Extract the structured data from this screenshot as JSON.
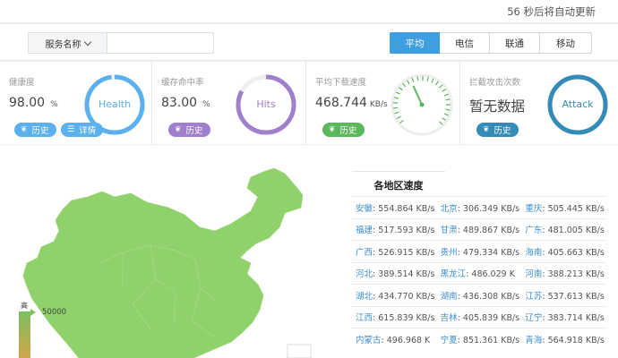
{
  "header": {
    "refresh_text": "56 秒后将自动更新"
  },
  "toolbar": {
    "service_select": "服务名称",
    "search_value": "",
    "isp_tabs": [
      {
        "label": "平均",
        "active": true
      },
      {
        "label": "电信",
        "active": false
      },
      {
        "label": "联通",
        "active": false
      },
      {
        "label": "移动",
        "active": false
      }
    ]
  },
  "cards": {
    "health": {
      "title": "健康度",
      "value": "98.00",
      "unit": "%",
      "ring_label": "Health",
      "ring_percent": 98.0,
      "history": "历史",
      "details": "详情",
      "color": "#5ab1ee"
    },
    "cache": {
      "title": "缓存命中率",
      "value": "83.00",
      "unit": "%",
      "ring_label": "Hits",
      "ring_percent": 83.0,
      "history": "历史",
      "color": "#a07fcd"
    },
    "speed": {
      "title": "平均下载速度",
      "value": "468.744",
      "unit": "KB/s",
      "history": "历史",
      "color": "#5cb85c"
    },
    "attack": {
      "title": "拦截攻击次数",
      "value": "暂无数据",
      "ring_label": "Attack",
      "ring_percent": 100,
      "history": "历史",
      "color": "#338bb8"
    }
  },
  "map": {
    "legend_high": "高",
    "legend_max": "50000",
    "fill_color": "#8fd16a"
  },
  "regions": {
    "title": "各地区速度",
    "rows": [
      [
        {
          "name": "安徽",
          "speed": "554.864 KB/s"
        },
        {
          "name": "北京",
          "speed": "306.349 KB/s"
        },
        {
          "name": "重庆",
          "speed": "505.445 KB/s"
        }
      ],
      [
        {
          "name": "福建",
          "speed": "517.593 KB/s"
        },
        {
          "name": "甘肃",
          "speed": "489.867 KB/s"
        },
        {
          "name": "广东",
          "speed": "481.005 KB/s"
        }
      ],
      [
        {
          "name": "广西",
          "speed": "526.915 KB/s"
        },
        {
          "name": "贵州",
          "speed": "479.334 KB/s"
        },
        {
          "name": "海南",
          "speed": "405.663 KB/s"
        }
      ],
      [
        {
          "name": "河北",
          "speed": "389.514 KB/s"
        },
        {
          "name": "黑龙江",
          "speed": "486.029 K"
        },
        {
          "name": "河南",
          "speed": "388.213 KB/s"
        }
      ],
      [
        {
          "name": "湖北",
          "speed": "434.770 KB/s"
        },
        {
          "name": "湖南",
          "speed": "436.308 KB/s"
        },
        {
          "name": "江苏",
          "speed": "537.613 KB/s"
        }
      ],
      [
        {
          "name": "江西",
          "speed": "615.839 KB/s"
        },
        {
          "name": "吉林",
          "speed": "405.839 KB/s"
        },
        {
          "name": "辽宁",
          "speed": "383.714 KB/s"
        }
      ],
      [
        {
          "name": "内蒙古",
          "speed": "496.968 K"
        },
        {
          "name": "宁夏",
          "speed": "851.361 KB/s"
        },
        {
          "name": "青海",
          "speed": "564.918 KB/s"
        }
      ]
    ]
  }
}
